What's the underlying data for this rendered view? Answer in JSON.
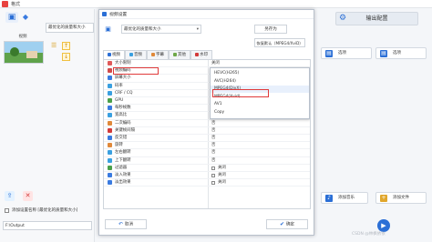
{
  "app": {
    "title": "格式",
    "file_tab": "视频",
    "preset_value": "最优化的质量和大小",
    "add_preset_label": "添加设置名称 [最优化的质量和大小]",
    "output_path": "F:\\Output",
    "output_config_label": "输出配置",
    "right_btn_1": "选项",
    "right_btn_2": "选项",
    "add_music_label": "添加音乐",
    "add_file_label": "添加文件",
    "watermark": "CSDN @林枫依依"
  },
  "dialog": {
    "title": "视频设置",
    "preset_value": "最优化的质量和大小",
    "save_as_label": "另存为",
    "default_label": "恢复默认（MPEG4/XviD）",
    "tabs": [
      {
        "label": "视频",
        "icon_color": "#2b6fd6"
      },
      {
        "label": "音频",
        "icon_color": "#3aa0e0"
      },
      {
        "label": "字幕",
        "icon_color": "#e0893a"
      },
      {
        "label": "其他",
        "icon_color": "#6fa84a"
      },
      {
        "label": "水印",
        "icon_color": "#d23a3a"
      }
    ],
    "rows": [
      {
        "name": "大小限制",
        "value": "关闭",
        "icon": "size-icon",
        "color": "#e05a5a"
      },
      {
        "name": "视频编码",
        "value": "MPEG4(DivX)",
        "icon": "video-codec-icon",
        "color": "#d04a4a"
      },
      {
        "name": "屏幕大小",
        "value": "",
        "icon": "screen-icon",
        "color": "#3a7be0"
      },
      {
        "name": "码率",
        "value": "",
        "icon": "bitrate-icon",
        "color": "#3aa0e0"
      },
      {
        "name": "CRF / CQ",
        "value": "",
        "icon": "crf-icon",
        "color": "#3aa0e0"
      },
      {
        "name": "GPU",
        "value": "",
        "icon": "gpu-icon",
        "color": "#4aa04a"
      },
      {
        "name": "每秒帧数",
        "value": "",
        "icon": "fps-icon",
        "color": "#3a7be0"
      },
      {
        "name": "宽高比",
        "value": "自动",
        "icon": "aspect-icon",
        "color": "#3aa0e0"
      },
      {
        "name": "二次编码",
        "value": "否",
        "icon": "two-pass-icon",
        "color": "#e0893a"
      },
      {
        "name": "关键帧间隔",
        "value": "否",
        "icon": "keyframe-icon",
        "color": "#d23a3a"
      },
      {
        "name": "反交错",
        "value": "否",
        "icon": "deinterlace-icon",
        "color": "#3a7be0"
      },
      {
        "name": "旋转",
        "value": "否",
        "icon": "rotate-icon",
        "color": "#e0893a"
      },
      {
        "name": "左右翻转",
        "value": "否",
        "icon": "flip-h-icon",
        "color": "#3aa0e0"
      },
      {
        "name": "上下翻转",
        "value": "否",
        "icon": "flip-v-icon",
        "color": "#3aa0e0"
      },
      {
        "name": "过滤器",
        "value": "关闭",
        "icon": "filter-icon",
        "color": "#4aa04a",
        "checkbox": true
      },
      {
        "name": "淡入效果",
        "value": "关闭",
        "icon": "fade-in-icon",
        "color": "#3a7be0",
        "checkbox": true
      },
      {
        "name": "淡出效果",
        "value": "关闭",
        "icon": "fade-out-icon",
        "color": "#3a7be0",
        "checkbox": true
      }
    ],
    "codec_options": [
      {
        "label": "HEVC(H265)",
        "selected": false
      },
      {
        "label": "AVC(H264)",
        "selected": false
      },
      {
        "label": "MPEG4(DivX)",
        "selected": true
      },
      {
        "label": "MPEG4(Xvid)",
        "selected": false
      },
      {
        "label": "AV1",
        "selected": false
      },
      {
        "label": "Copy",
        "selected": false
      }
    ],
    "cancel_label": "取消",
    "confirm_label": "确定"
  }
}
